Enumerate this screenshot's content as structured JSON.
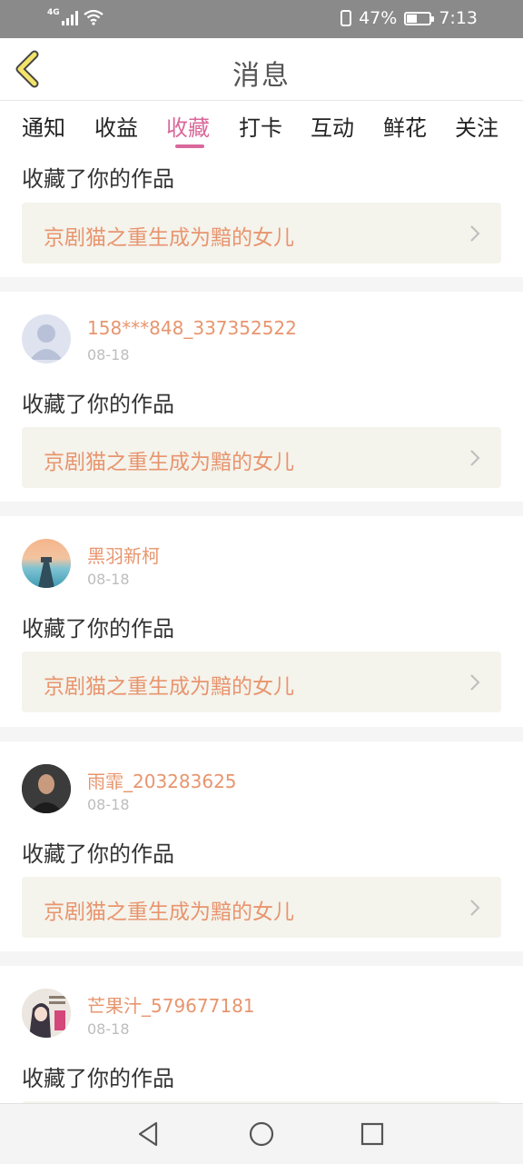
{
  "status_bar": {
    "network": "4G",
    "battery_percent": "47%",
    "time": "7:13"
  },
  "header": {
    "title": "消息",
    "back_icon": "chevron-left-icon"
  },
  "tabs": [
    {
      "label": "通知"
    },
    {
      "label": "收益"
    },
    {
      "label": "收藏",
      "active": true
    },
    {
      "label": "打卡"
    },
    {
      "label": "互动"
    },
    {
      "label": "鲜花"
    },
    {
      "label": "关注"
    }
  ],
  "colors": {
    "accent": "#d9689b",
    "username": "#e8956e",
    "work_bg": "#f4f3ec"
  },
  "notifications": [
    {
      "user": "",
      "date": "",
      "action": "收藏了你的作品",
      "work": "京剧猫之重生成为黯的女儿"
    },
    {
      "user": "158***848_337352522",
      "date": "08-18",
      "action": "收藏了你的作品",
      "work": "京剧猫之重生成为黯的女儿"
    },
    {
      "user": "黑羽新柯",
      "date": "08-18",
      "action": "收藏了你的作品",
      "work": "京剧猫之重生成为黯的女儿"
    },
    {
      "user": "雨霏_203283625",
      "date": "08-18",
      "action": "收藏了你的作品",
      "work": "京剧猫之重生成为黯的女儿"
    },
    {
      "user": "芒果汁_579677181",
      "date": "08-18",
      "action": "收藏了你的作品",
      "work": ""
    }
  ],
  "navbar": {
    "back": "triangle-back-icon",
    "home": "circle-home-icon",
    "recents": "square-recents-icon"
  }
}
